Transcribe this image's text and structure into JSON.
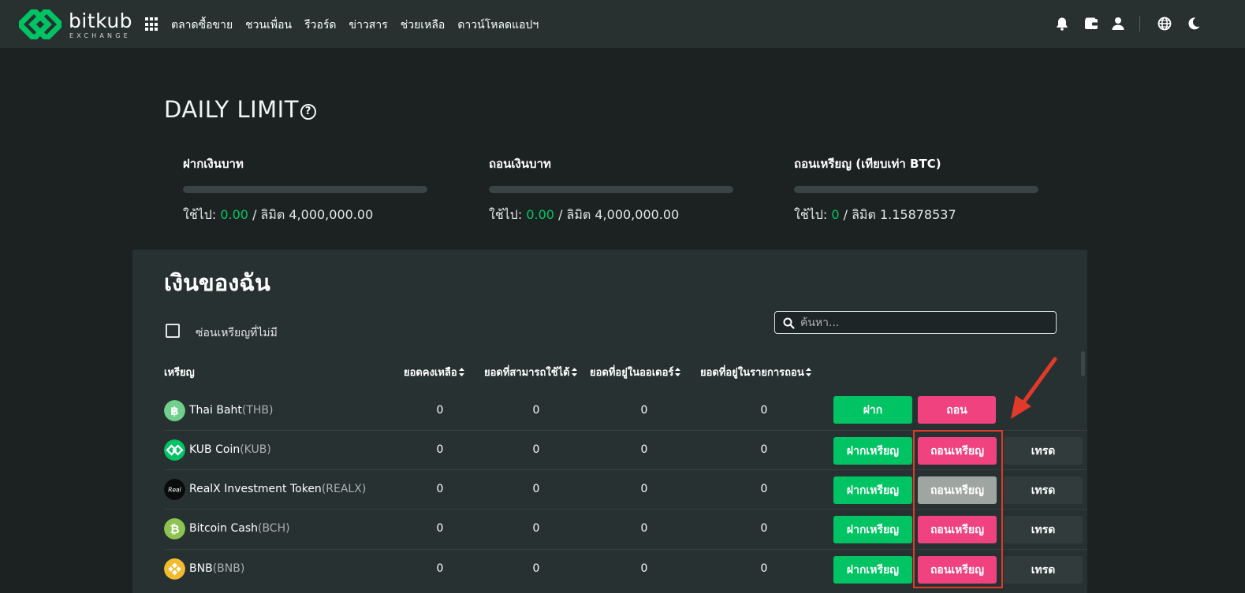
{
  "brand": {
    "name": "bitkub",
    "sub": "EXCHANGE"
  },
  "nav": [
    "ตลาดซื้อขาย",
    "ชวนเพื่อน",
    "รีวอร์ด",
    "ข่าวสาร",
    "ช่วยเหลือ",
    "ดาวน์โหลดแอปฯ"
  ],
  "daily_limit": {
    "title": "DAILY LIMIT",
    "items": [
      {
        "label": "ฝากเงินบาท",
        "used_prefix": "ใช้ไป: ",
        "used": "0.00",
        "limit_text": " / ลิมิต 4,000,000.00",
        "progress": 0
      },
      {
        "label": "ถอนเงินบาท",
        "used_prefix": "ใช้ไป: ",
        "used": "0.00",
        "limit_text": " / ลิมิต 4,000,000.00",
        "progress": 0
      },
      {
        "label": "ถอนเหรียญ (เทียบเท่า BTC)",
        "used_prefix": "ใช้ไป: ",
        "used": "0",
        "limit_text": " / ลิมิต 1.15878537",
        "progress": 0
      }
    ]
  },
  "wallet": {
    "title": "เงินของฉัน",
    "hide_zero_label": "ซ่อนเหรียญที่ไม่มี",
    "search_placeholder": "ค้นหา...",
    "columns": {
      "coin": "เหรียญ",
      "balance": "ยอดคงเหลือ",
      "available": "ยอดที่สามารถใช้ได้",
      "in_orders": "ยอดที่อยู่ในออเดอร์",
      "in_withdrawals": "ยอดที่อยู่ในรายการถอน"
    },
    "rows": [
      {
        "name": "Thai Baht",
        "symbol": "(THB)",
        "balance": "0",
        "available": "0",
        "in_orders": "0",
        "in_withdrawals": "0",
        "deposit": "ฝาก",
        "withdraw": "ถอน"
      },
      {
        "name": "KUB Coin",
        "symbol": "(KUB)",
        "balance": "0",
        "available": "0",
        "in_orders": "0",
        "in_withdrawals": "0",
        "deposit": "ฝากเหรียญ",
        "withdraw": "ถอนเหรียญ",
        "trade": "เทรด"
      },
      {
        "name": "RealX Investment Token",
        "symbol": "(REALX)",
        "balance": "0",
        "available": "0",
        "in_orders": "0",
        "in_withdrawals": "0",
        "deposit": "ฝากเหรียญ",
        "withdraw": "ถอนเหรียญ",
        "trade": "เทรด",
        "withdraw_disabled": true
      },
      {
        "name": "Bitcoin Cash",
        "symbol": "(BCH)",
        "balance": "0",
        "available": "0",
        "in_orders": "0",
        "in_withdrawals": "0",
        "deposit": "ฝากเหรียญ",
        "withdraw": "ถอนเหรียญ",
        "trade": "เทรด"
      },
      {
        "name": "BNB",
        "symbol": "(BNB)",
        "balance": "0",
        "available": "0",
        "in_orders": "0",
        "in_withdrawals": "0",
        "deposit": "ฝากเหรียญ",
        "withdraw": "ถอนเหรียญ",
        "trade": "เทรด"
      }
    ]
  },
  "colors": {
    "accent_green": "#00c464",
    "accent_pink": "#f0427f",
    "annotation_red": "#e13a2b"
  }
}
